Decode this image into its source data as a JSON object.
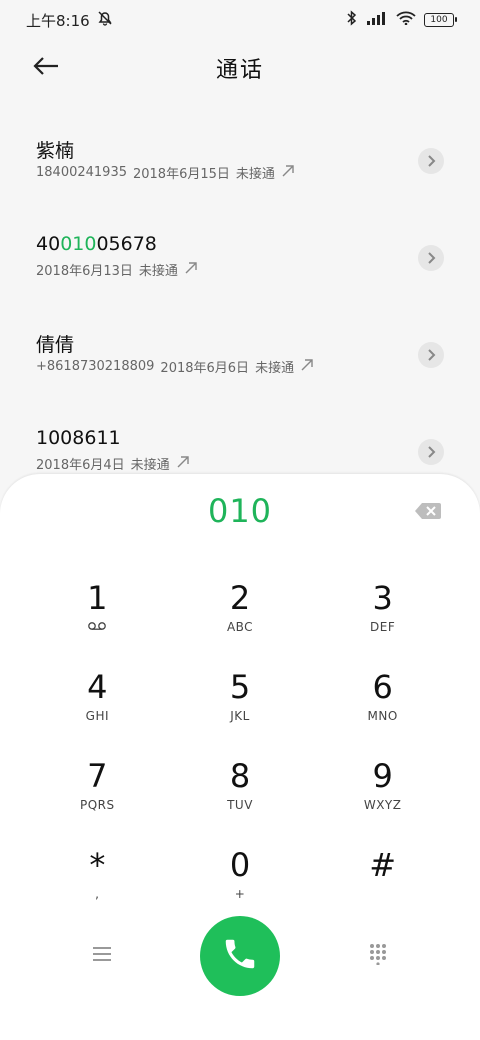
{
  "status_bar": {
    "time": "上午8:16",
    "battery": "100",
    "icons": [
      "notification-mute-icon",
      "bluetooth-icon",
      "signal-icon",
      "wifi-icon",
      "battery-icon"
    ]
  },
  "header": {
    "title": "通话",
    "back_icon": "arrow-left-icon"
  },
  "calls": [
    {
      "name": "紫楠",
      "name_pre": "紫楠",
      "name_hl": "",
      "name_post": "",
      "number": "18400241935",
      "date": "2018年6月15日",
      "status": "未接通"
    },
    {
      "name": "4001005678",
      "name_pre": "40",
      "name_hl": "010",
      "name_post": "05678",
      "number": "",
      "date": "2018年6月13日",
      "status": "未接通"
    },
    {
      "name": "倩倩",
      "name_pre": "倩倩",
      "name_hl": "",
      "name_post": "",
      "number": "+8618730218809",
      "date": "2018年6月6日",
      "status": "未接通"
    },
    {
      "name": "1008611",
      "name_pre": "1008611",
      "name_hl": "",
      "name_post": "",
      "number": "",
      "date": "2018年6月4日",
      "status": "未接通"
    }
  ],
  "dialer": {
    "input": "010",
    "keys": [
      {
        "digit": "1",
        "letters": ""
      },
      {
        "digit": "2",
        "letters": "ABC"
      },
      {
        "digit": "3",
        "letters": "DEF"
      },
      {
        "digit": "4",
        "letters": "GHI"
      },
      {
        "digit": "5",
        "letters": "JKL"
      },
      {
        "digit": "6",
        "letters": "MNO"
      },
      {
        "digit": "7",
        "letters": "PQRS"
      },
      {
        "digit": "8",
        "letters": "TUV"
      },
      {
        "digit": "9",
        "letters": "WXYZ"
      },
      {
        "digit": "*",
        "letters": ","
      },
      {
        "digit": "0",
        "letters": "+"
      },
      {
        "digit": "#",
        "letters": ""
      }
    ]
  },
  "colors": {
    "accent": "#1fb45a",
    "call_button": "#1fbf5a",
    "background": "#f6f6f6"
  }
}
